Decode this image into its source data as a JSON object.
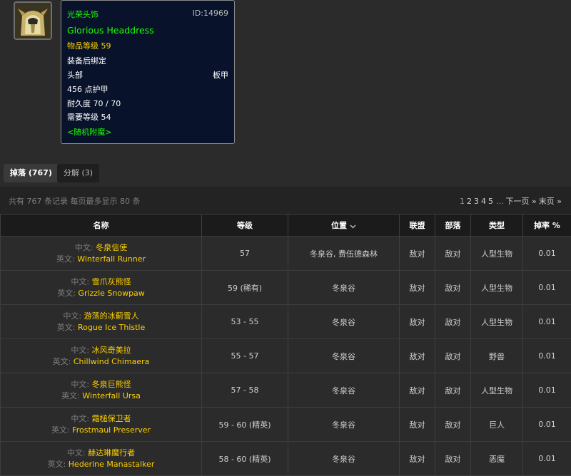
{
  "item": {
    "icon": "helmet-icon",
    "name_cn": "光荣头饰",
    "id_label": "ID:14969",
    "name_en": "Glorious Headdress",
    "item_level": "物品等级 59",
    "bind": "装备后绑定",
    "slot": "头部",
    "armor_type": "板甲",
    "armor": "456 点护甲",
    "durability": "耐久度 70 / 70",
    "required_level": "需要等级 54",
    "enchant": "<随机附魔>",
    "colors": {
      "uncommon": "#1eff00",
      "level": "#ffd100",
      "tooltip_bg": "#08132b"
    }
  },
  "tabs": [
    {
      "label": "掉落 (767)",
      "active": true
    },
    {
      "label": "分解 (3)",
      "active": false
    }
  ],
  "records": "共有 767 条记录 每页最多显示 80 条",
  "pager": {
    "current": "1",
    "pages": [
      "2",
      "3",
      "4",
      "5"
    ],
    "ellipsis": "...",
    "next": "下一页 »",
    "last": "末页 »"
  },
  "table": {
    "headers": {
      "name": "名称",
      "level": "等级",
      "location": "位置",
      "alliance": "联盟",
      "horde": "部落",
      "type": "类型",
      "rate": "掉率 %"
    },
    "lang_cn": "中文:",
    "lang_en": "英文:",
    "rows": [
      {
        "cn": "冬泉信使",
        "en": "Winterfall Runner",
        "level": "57",
        "location": "冬泉谷, 费伍德森林",
        "alliance": "敌对",
        "horde": "敌对",
        "type": "人型生物",
        "rate": "0.01"
      },
      {
        "cn": "雪爪灰熊怪",
        "en": "Grizzle Snowpaw",
        "level": "59 (稀有)",
        "location": "冬泉谷",
        "alliance": "敌对",
        "horde": "敌对",
        "type": "人型生物",
        "rate": "0.01"
      },
      {
        "cn": "游荡的冰蓟雪人",
        "en": "Rogue Ice Thistle",
        "level": "53 - 55",
        "location": "冬泉谷",
        "alliance": "敌对",
        "horde": "敌对",
        "type": "人型生物",
        "rate": "0.01"
      },
      {
        "cn": "冰风奇美拉",
        "en": "Chillwind Chimaera",
        "level": "55 - 57",
        "location": "冬泉谷",
        "alliance": "敌对",
        "horde": "敌对",
        "type": "野兽",
        "rate": "0.01"
      },
      {
        "cn": "冬泉巨熊怪",
        "en": "Winterfall Ursa",
        "level": "57 - 58",
        "location": "冬泉谷",
        "alliance": "敌对",
        "horde": "敌对",
        "type": "人型生物",
        "rate": "0.01"
      },
      {
        "cn": "霜槌保卫者",
        "en": "Frostmaul Preserver",
        "level": "59 - 60 (精英)",
        "location": "冬泉谷",
        "alliance": "敌对",
        "horde": "敌对",
        "type": "巨人",
        "rate": "0.01"
      },
      {
        "cn": "赫达琳魔行者",
        "en": "Hederine Manastalker",
        "level": "58 - 60 (精英)",
        "location": "冬泉谷",
        "alliance": "敌对",
        "horde": "敌对",
        "type": "恶魔",
        "rate": "0.01"
      }
    ]
  }
}
